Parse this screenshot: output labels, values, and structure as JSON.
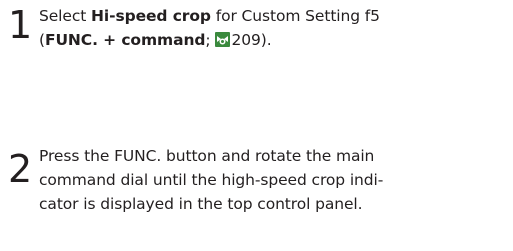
{
  "steps": [
    {
      "number": "1",
      "lines": [
        {
          "prefix": "Select ",
          "bold": "Hi-speed crop",
          "suffix": " for Custom Setting f5"
        },
        {
          "open": "(",
          "bold": "FUNC. + command",
          "semicolon": ";",
          "icon": "page-reference-icon",
          "page": "209).",
          "accent": "#3b8a3e"
        }
      ]
    },
    {
      "number": "2",
      "lines": [
        "Press the FUNC. button and rotate the main",
        "command dial until the high-speed crop indi-",
        "cator is displayed in the top control panel."
      ]
    }
  ]
}
